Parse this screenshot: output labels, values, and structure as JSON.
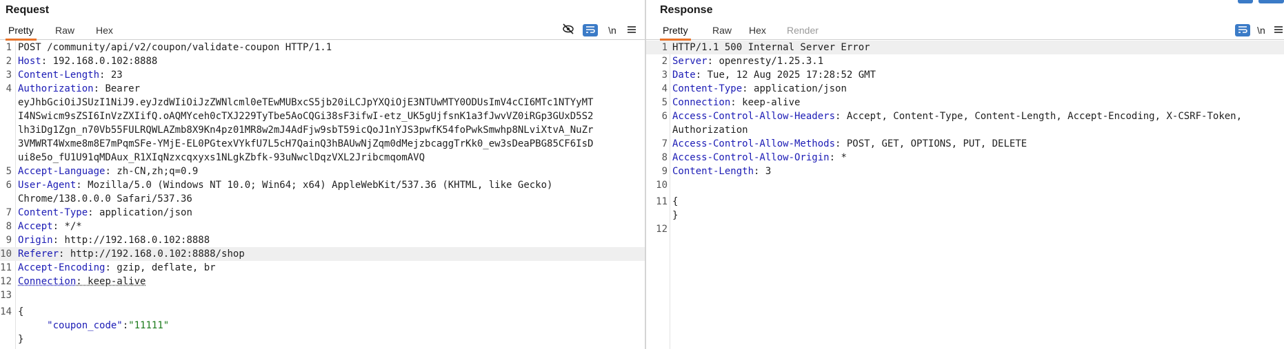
{
  "request": {
    "title": "Request",
    "tabs": [
      "Pretty",
      "Raw",
      "Hex"
    ],
    "active_tab": "Pretty",
    "tools": {
      "hide_icon": "eye-off-icon",
      "wrap_icon": "word-wrap-icon",
      "newline_label": "\\n",
      "menu_icon": "menu-icon"
    },
    "line_numbers": [
      "1",
      "2",
      "3",
      "4",
      "5",
      "6",
      "7",
      "8",
      "9",
      "10",
      "11",
      "12",
      "13",
      "14"
    ],
    "request_line": "POST /community/api/v2/coupon/validate-coupon HTTP/1.1",
    "headers": [
      {
        "name": "Host",
        "value": " 192.168.0.102:8888"
      },
      {
        "name": "Content-Length",
        "value": " 23"
      },
      {
        "name": "Authorization",
        "value": " Bearer"
      },
      {
        "name": "Accept-Language",
        "value": " zh-CN,zh;q=0.9"
      },
      {
        "name": "User-Agent",
        "value": " Mozilla/5.0 (Windows NT 10.0; Win64; x64) AppleWebKit/537.36 (KHTML, like Gecko)"
      },
      {
        "name": "Content-Type",
        "value": " application/json"
      },
      {
        "name": "Accept",
        "value": " */*"
      },
      {
        "name": "Origin",
        "value": " http://192.168.0.102:8888"
      },
      {
        "name": "Referer",
        "value": " http://192.168.0.102:8888/shop"
      },
      {
        "name": "Accept-Encoding",
        "value": " gzip, deflate, br"
      },
      {
        "name": "Connection",
        "value": " keep-alive"
      }
    ],
    "token_lines": [
      "eyJhbGciOiJSUzI1NiJ9.eyJzdWIiOiJzZWNlcml0eTEwMUBxcS5jb20iLCJpYXQiOjE3NTUwMTY0ODUsImV4cCI6MTc1NTYyMT",
      "I4NSwicm9sZSI6InVzZXIifQ.oAQMYceh0cTXJ229TyTbe5AoCQGi38sF3ifwI-etz_UK5gUjfsnK1a3fJwvVZ0iRGp3GUxD5S2",
      "lh3iDg1Zgn_n70Vb55FULRQWLAZmb8X9Kn4pz01MR8w2mJ4AdFjw9sbT59icQoJ1nYJS3pwfK54foPwkSmwhp8NLviXtvA_NuZr",
      "3VMWRT4Wxme8m8E7mPqmSFe-YMjE-EL0PGtexVYkfU7L5cH7QainQ3hBAUwNjZqm0dMejzbcaggTrKk0_ew3sDeaPBG85CF6IsD",
      "ui8e5o_fU1U91qMDAux_R1XIqNzxcqxyxs1NLgkZbfk-93uNwclDqzVXL2JribcmqomAVQ"
    ],
    "ua_cont": "Chrome/138.0.0.0 Safari/537.36",
    "body_open": "{",
    "body_key": "\"coupon_code\"",
    "body_sep": ":",
    "body_value": "\"11111\"",
    "body_close": "}"
  },
  "response": {
    "title": "Response",
    "tabs": [
      "Pretty",
      "Raw",
      "Hex",
      "Render"
    ],
    "active_tab": "Pretty",
    "tools": {
      "wrap_icon": "word-wrap-icon",
      "newline_label": "\\n",
      "menu_icon": "menu-icon"
    },
    "line_numbers": [
      "1",
      "2",
      "3",
      "4",
      "5",
      "6",
      "7",
      "8",
      "9",
      "10",
      "11",
      "12"
    ],
    "status_line": "HTTP/1.1 500 Internal Server Error",
    "headers": [
      {
        "name": "Server",
        "value": " openresty/1.25.3.1"
      },
      {
        "name": "Date",
        "value": " Tue, 12 Aug 2025 17:28:52 GMT"
      },
      {
        "name": "Content-Type",
        "value": " application/json"
      },
      {
        "name": "Connection",
        "value": " keep-alive"
      },
      {
        "name": "Access-Control-Allow-Headers",
        "value": " Accept, Content-Type, Content-Length, Accept-Encoding, X-CSRF-Token,"
      },
      {
        "name": "Access-Control-Allow-Methods",
        "value": " POST, GET, OPTIONS, PUT, DELETE"
      },
      {
        "name": "Access-Control-Allow-Origin",
        "value": " *"
      },
      {
        "name": "Content-Length",
        "value": " 3"
      }
    ],
    "allow_headers_cont": "Authorization",
    "body_open": "{",
    "body_close": "}"
  },
  "colors": {
    "header_name": "#1b1bb5",
    "string": "#1b7a1b",
    "active_tab": "#e8742b",
    "tool_blue": "#3b7bc7"
  }
}
